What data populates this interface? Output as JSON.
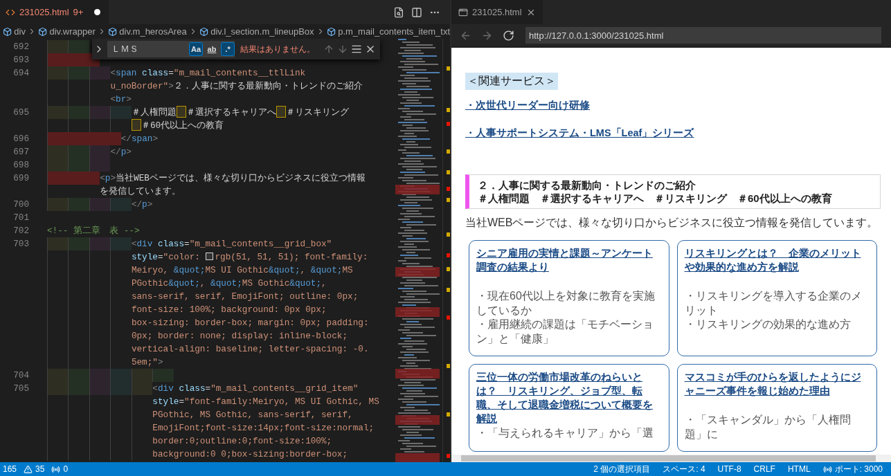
{
  "editor": {
    "tab": {
      "title": "231025.html",
      "badge": "9+",
      "modified": true
    },
    "breadcrumbs": [
      "div",
      "div.wrapper",
      "div.m_herosArea",
      "div.l_section.m_lineupBox",
      "p.m_mail_contents_item_txt"
    ],
    "find": {
      "value": "ＬＭＳ",
      "options": [
        {
          "label": "Aa",
          "selected": true
        },
        {
          "label": "ab",
          "selected": false
        },
        {
          "label": ".*",
          "selected": true
        }
      ],
      "message": "結果はありません。"
    },
    "lines": [
      {
        "number": "692",
        "rows": [
          {
            "tokens": [
              {
                "kind": "indent",
                "bands": [
                  {
                    "kind": "full"
                  },
                  {
                    "kind": "full"
                  }
                ]
              }
            ]
          }
        ]
      },
      {
        "number": "693",
        "rows": [
          {
            "tokens": [
              {
                "kind": "indent",
                "bands": [
                  {
                    "kind": "full"
                  },
                  {
                    "kind": "full"
                  },
                  {
                    "kind": "half"
                  }
                ]
              }
            ]
          }
        ]
      },
      {
        "number": "694",
        "rows": [
          {
            "tokens": [
              {
                "kind": "indent",
                "bands": [
                  {
                    "kind": "full"
                  },
                  {
                    "kind": "full"
                  },
                  {
                    "kind": "full"
                  }
                ]
              },
              {
                "kind": "bracket",
                "text": "<"
              },
              {
                "kind": "tag",
                "text": "span"
              },
              {
                "kind": "attr",
                "text": " class"
              },
              {
                "kind": "plain",
                "text": "="
              },
              {
                "kind": "str",
                "text": "\"m_mail_contents__ttlLink"
              }
            ]
          },
          {
            "tokens": [
              {
                "kind": "str",
                "text": "u_noBorder\""
              },
              {
                "kind": "bracket",
                "text": ">"
              },
              {
                "kind": "plain",
                "text": "２．人事に関する最新動向・トレンドのご紹介"
              }
            ]
          },
          {
            "tokens": [
              {
                "kind": "bracket",
                "text": "<"
              },
              {
                "kind": "tag",
                "text": "br"
              },
              {
                "kind": "bracket",
                "text": ">"
              }
            ]
          }
        ]
      },
      {
        "number": "695",
        "rows": [
          {
            "tokens": [
              {
                "kind": "indent",
                "bands": [
                  {
                    "kind": "full"
                  },
                  {
                    "kind": "full"
                  },
                  {
                    "kind": "full"
                  },
                  {
                    "kind": "full"
                  }
                ]
              },
              {
                "kind": "plain",
                "text": "＃人権問題"
              },
              {
                "kind": "wide"
              },
              {
                "kind": "plain",
                "text": "＃選択するキャリアへ"
              },
              {
                "kind": "wide"
              },
              {
                "kind": "plain",
                "text": "＃リスキリング"
              }
            ]
          },
          {
            "tokens": [
              {
                "kind": "wide"
              },
              {
                "kind": "plain",
                "text": "＃60代以上への教育"
              }
            ]
          }
        ]
      },
      {
        "number": "696",
        "rows": [
          {
            "tokens": [
              {
                "kind": "indent",
                "bands": [
                  {
                    "kind": "full"
                  },
                  {
                    "kind": "full"
                  },
                  {
                    "kind": "full"
                  },
                  {
                    "kind": "half"
                  }
                ]
              },
              {
                "kind": "bracket",
                "text": "</"
              },
              {
                "kind": "tag",
                "text": "span"
              },
              {
                "kind": "bracket",
                "text": ">"
              }
            ]
          }
        ]
      },
      {
        "number": "697",
        "rows": [
          {
            "tokens": [
              {
                "kind": "indent",
                "bands": [
                  {
                    "kind": "full"
                  },
                  {
                    "kind": "full"
                  },
                  {
                    "kind": "full"
                  }
                ]
              },
              {
                "kind": "bracket",
                "text": "</"
              },
              {
                "kind": "tag",
                "text": "p"
              },
              {
                "kind": "bracket",
                "text": ">"
              }
            ]
          }
        ]
      },
      {
        "number": "698",
        "rows": [
          {
            "tokens": [
              {
                "kind": "indent",
                "bands": [
                  {
                    "kind": "full"
                  },
                  {
                    "kind": "full"
                  },
                  {
                    "kind": "full"
                  }
                ]
              }
            ]
          }
        ]
      },
      {
        "number": "699",
        "rows": [
          {
            "tokens": [
              {
                "kind": "indent",
                "bands": [
                  {
                    "kind": "full"
                  },
                  {
                    "kind": "full"
                  },
                  {
                    "kind": "half"
                  }
                ]
              },
              {
                "kind": "bracket",
                "text": "<"
              },
              {
                "kind": "tag",
                "text": "p"
              },
              {
                "kind": "bracket",
                "text": ">"
              },
              {
                "kind": "plain",
                "text": "当社WEBページでは、様々な切り口からビジネスに役立つ情報"
              }
            ]
          },
          {
            "tokens": [
              {
                "kind": "plain",
                "text": "を発信しています。"
              }
            ]
          }
        ]
      },
      {
        "number": "700",
        "rows": [
          {
            "tokens": [
              {
                "kind": "indent",
                "bands": [
                  {
                    "kind": "full"
                  },
                  {
                    "kind": "full"
                  },
                  {
                    "kind": "full"
                  },
                  {
                    "kind": "full"
                  }
                ]
              },
              {
                "kind": "bracket",
                "text": "</"
              },
              {
                "kind": "tag",
                "text": "p"
              },
              {
                "kind": "bracket",
                "text": ">"
              }
            ]
          }
        ]
      },
      {
        "number": "701"
      },
      {
        "number": "702",
        "rows": [
          {
            "tokens": [
              {
                "kind": "comment",
                "text": "<!-- 第二章　表 -->"
              }
            ]
          }
        ]
      },
      {
        "number": "703",
        "rows": [
          {
            "tokens": [
              {
                "kind": "indent",
                "bands": [
                  {
                    "kind": "full"
                  },
                  {
                    "kind": "full"
                  },
                  {
                    "kind": "full"
                  },
                  {
                    "kind": "full"
                  }
                ]
              },
              {
                "kind": "bracket",
                "text": "<"
              },
              {
                "kind": "tag",
                "text": "div"
              },
              {
                "kind": "attr",
                "text": " class"
              },
              {
                "kind": "plain",
                "text": "="
              },
              {
                "kind": "str",
                "text": "\"m_mail_contents__grid_box\""
              }
            ]
          },
          {
            "tokens": [
              {
                "kind": "attr",
                "text": "style"
              },
              {
                "kind": "plain",
                "text": "="
              },
              {
                "kind": "str",
                "text": "\"color: "
              },
              {
                "kind": "swatch",
                "color": "#333333"
              },
              {
                "kind": "str",
                "text": "rgb(51, 51, 51); font-family:"
              }
            ]
          },
          {
            "tokens": [
              {
                "kind": "str",
                "text": "Meiryo, "
              },
              {
                "kind": "entity",
                "text": "&quot;"
              },
              {
                "kind": "str",
                "text": "MS UI Gothic"
              },
              {
                "kind": "entity",
                "text": "&quot;"
              },
              {
                "kind": "str",
                "text": ", "
              },
              {
                "kind": "entity",
                "text": "&quot;"
              },
              {
                "kind": "str",
                "text": "MS"
              }
            ]
          },
          {
            "tokens": [
              {
                "kind": "str",
                "text": "PGothic"
              },
              {
                "kind": "entity",
                "text": "&quot;"
              },
              {
                "kind": "str",
                "text": ", "
              },
              {
                "kind": "entity",
                "text": "&quot;"
              },
              {
                "kind": "str",
                "text": "MS Gothic"
              },
              {
                "kind": "entity",
                "text": "&quot;"
              },
              {
                "kind": "str",
                "text": ","
              }
            ]
          },
          {
            "tokens": [
              {
                "kind": "str",
                "text": "sans-serif, serif, EmojiFont; outline: 0px;"
              }
            ]
          },
          {
            "tokens": [
              {
                "kind": "str",
                "text": "font-size: 100%; background: 0px 0px;"
              }
            ]
          },
          {
            "tokens": [
              {
                "kind": "str",
                "text": "box-sizing: border-box; margin: 0px; padding:"
              }
            ]
          },
          {
            "tokens": [
              {
                "kind": "str",
                "text": "0px; border: none; display: inline-block;"
              }
            ]
          },
          {
            "tokens": [
              {
                "kind": "str",
                "text": "vertical-align: baseline; letter-spacing: -0."
              }
            ]
          },
          {
            "tokens": [
              {
                "kind": "str",
                "text": "5em;\""
              },
              {
                "kind": "bracket",
                "text": ">"
              }
            ]
          }
        ]
      },
      {
        "number": "704",
        "rows": [
          {
            "tokens": [
              {
                "kind": "indent",
                "bands": [
                  {
                    "kind": "full"
                  },
                  {
                    "kind": "full"
                  },
                  {
                    "kind": "full"
                  },
                  {
                    "kind": "full"
                  },
                  {
                    "kind": "full"
                  },
                  {
                    "kind": "full"
                  }
                ]
              }
            ]
          }
        ]
      },
      {
        "number": "705",
        "rows": [
          {
            "tokens": [
              {
                "kind": "indent",
                "bands": [
                  {
                    "kind": "full"
                  },
                  {
                    "kind": "full"
                  },
                  {
                    "kind": "full"
                  },
                  {
                    "kind": "full"
                  },
                  {
                    "kind": "full"
                  }
                ]
              },
              {
                "kind": "bracket",
                "text": "<"
              },
              {
                "kind": "tag",
                "text": "div"
              },
              {
                "kind": "attr",
                "text": " class"
              },
              {
                "kind": "plain",
                "text": "="
              },
              {
                "kind": "str",
                "text": "\"m_mail_contents__grid_item\""
              }
            ]
          },
          {
            "tokens": [
              {
                "kind": "attr",
                "text": "style"
              },
              {
                "kind": "plain",
                "text": "="
              },
              {
                "kind": "str",
                "text": "\"font-family:Meiryo, MS UI Gothic, MS"
              }
            ]
          },
          {
            "tokens": [
              {
                "kind": "str",
                "text": "PGothic, MS Gothic, sans-serif, serif,"
              }
            ]
          },
          {
            "tokens": [
              {
                "kind": "str",
                "text": "EmojiFont;font-size:14px;font-size:normal;"
              }
            ]
          },
          {
            "tokens": [
              {
                "kind": "str",
                "text": "border:0;outline:0;font-size:100%;"
              }
            ]
          },
          {
            "tokens": [
              {
                "kind": "str",
                "text": "background:0 0;box-sizing:border-box;"
              }
            ]
          }
        ]
      }
    ]
  },
  "preview": {
    "tab": {
      "title": "231025.html"
    },
    "nav": [
      {
        "kind": "back",
        "disabled": true
      },
      {
        "kind": "forward",
        "disabled": true
      },
      {
        "kind": "reload",
        "disabled": false
      }
    ],
    "url": "http://127.0.0.1:3000/231025.html",
    "heading": "＜関連サービス＞",
    "links": [
      "・次世代リーダー向け研修",
      "・人事サポートシステム・LMS「Leaf」シリーズ"
    ],
    "section": {
      "title": "２．人事に関する最新動向・トレンドのご紹介",
      "tags": "＃人権問題　＃選択するキャリアへ　＃リスキリング　＃60代以上への教育"
    },
    "intro": "当社WEBページでは、様々な切り口からビジネスに役立つ情報を発信しています。",
    "cards": [
      {
        "title": "シニア雇用の実情と課題～アンケート調査の結果より",
        "bullets": [
          "・現在60代以上を対象に教育を実施しているか",
          "・雇用継続の課題は「モチベーション」と「健康」"
        ]
      },
      {
        "title": "リスキリングとは？　企業のメリットや効果的な進め方を解説",
        "bullets": [
          "・リスキリングを導入する企業のメリット",
          "・リスキリングの効果的な進め方"
        ]
      },
      {
        "title": "三位一体の労働市場改革のねらいとは？　リスキリング、ジョブ型、転職、そして退職金増税について概要を解説",
        "bullets": [
          "・「与えられるキャリア」から「選"
        ]
      },
      {
        "title": "マスコミが手のひらを返したようにジャニーズ事件を報じ始めた理由",
        "bullets": [
          "・「スキャンダル」から「人権問題」に"
        ]
      }
    ]
  },
  "status_bar": {
    "left": [
      {
        "kind": "errors",
        "text": "165"
      },
      {
        "kind": "warnings",
        "text": "35"
      },
      {
        "kind": "ports",
        "text": "0"
      }
    ],
    "right": [
      {
        "kind": "selection",
        "text": "2 個の選択項目"
      },
      {
        "kind": "indent",
        "text": "スペース: 4"
      },
      {
        "kind": "encoding",
        "text": "UTF-8"
      },
      {
        "kind": "eol",
        "text": "CRLF"
      },
      {
        "kind": "language",
        "text": "HTML"
      },
      {
        "kind": "port",
        "text": "ポート: 3000"
      }
    ]
  }
}
